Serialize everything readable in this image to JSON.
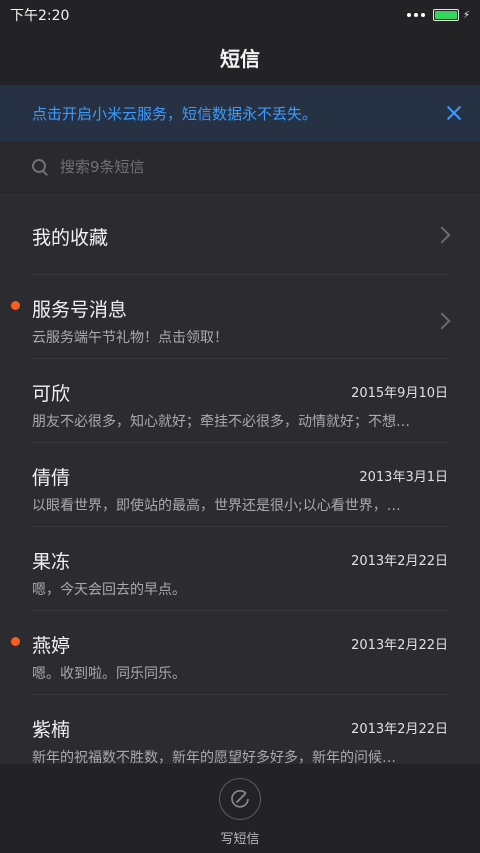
{
  "status_bar": {
    "time": "下午2:20"
  },
  "header": {
    "title": "短信"
  },
  "banner": {
    "text": "点击开启小米云服务，短信数据永不丢失。"
  },
  "search": {
    "placeholder": "搜索9条短信"
  },
  "favorites": {
    "label": "我的收藏"
  },
  "service": {
    "name": "服务号消息",
    "preview": "云服务端午节礼物！点击领取！",
    "unread": true
  },
  "conversations": [
    {
      "name": "可欣",
      "date": "2015年9月10日",
      "preview": "朋友不必很多，知心就好；牵挂不必很多，动情就好；不想…",
      "unread": false
    },
    {
      "name": "倩倩",
      "date": "2013年3月1日",
      "preview": "以眼看世界，即使站的最高，世界还是很小;以心看世界，…",
      "unread": false
    },
    {
      "name": "果冻",
      "date": "2013年2月22日",
      "preview": "嗯，今天会回去的早点。",
      "unread": false
    },
    {
      "name": "燕婷",
      "date": "2013年2月22日",
      "preview": "嗯。收到啦。同乐同乐。",
      "unread": true
    },
    {
      "name": "紫楠",
      "date": "2013年2月22日",
      "preview": "新年的祝福数不胜数，新年的愿望好多好多，新年的问候…",
      "unread": false
    }
  ],
  "compose": {
    "label": "写短信"
  },
  "colors": {
    "accent": "#3a9bff",
    "unread": "#ff5a1f",
    "battery": "#35d65c"
  }
}
